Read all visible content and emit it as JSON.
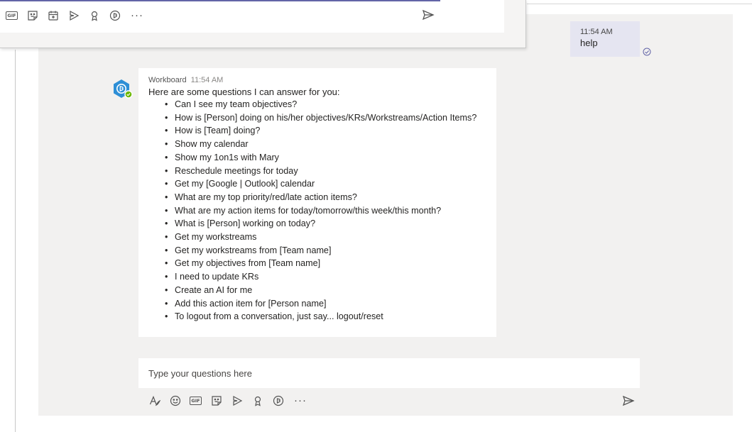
{
  "overlay_compose": {
    "tools": [
      "gif-icon",
      "sticker-icon",
      "meeting-icon",
      "stream-icon",
      "praise-icon",
      "workboard-icon",
      "more-icon"
    ],
    "more_label": "···"
  },
  "user_message": {
    "time": "11:54 AM",
    "text": "help"
  },
  "bot_message": {
    "sender": "Workboard",
    "time": "11:54 AM",
    "intro": "Here are some questions I can answer for you:",
    "questions": [
      "Can I see my team objectives?",
      "How is [Person] doing on his/her objectives/KRs/Workstreams/Action Items?",
      "How is [Team] doing?",
      "Show my calendar",
      "Show my 1on1s with Mary",
      "Reschedule meetings for today",
      "Get my [Google | Outlook] calendar",
      "What are my top priority/red/late action items?",
      "What are my action items for today/tomorrow/this week/this month?",
      "What is [Person] working on today?",
      "Get my workstreams",
      "Get my workstreams from [Team name]",
      "Get my objectives from [Team name]",
      "I need to update KRs",
      "Create an AI for me",
      "Add this action item for [Person name]",
      "To logout from a conversation, just say... logout/reset"
    ]
  },
  "compose": {
    "placeholder": "Type your questions here",
    "tools": [
      "format-icon",
      "emoji-icon",
      "gif-icon",
      "sticker-icon",
      "stream-icon",
      "praise-icon",
      "workboard-icon",
      "more-icon"
    ],
    "more_label": "···"
  },
  "colors": {
    "accent": "#6264a7",
    "chat_background": "#f2f1f0",
    "user_bubble": "#e5e5f1",
    "avatar": "#2e8fd6",
    "online": "#6bb700"
  }
}
